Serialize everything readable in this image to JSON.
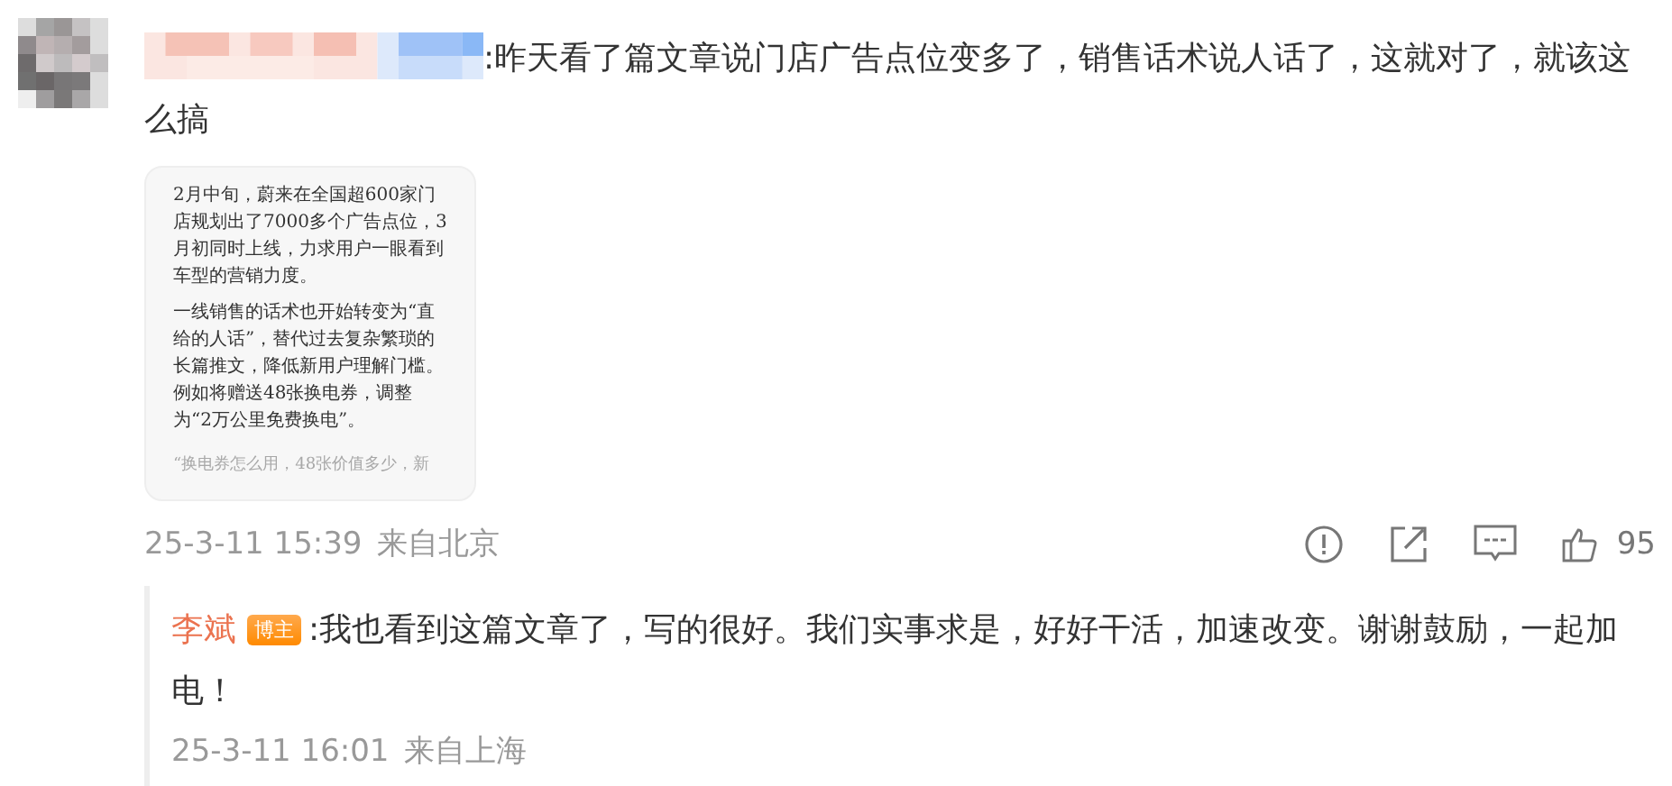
{
  "comment": {
    "text": ":昨天看了篇文章说门店广告点位变多了，销售话术说人话了，这就对了，就该这么搞",
    "attachment": {
      "paragraphs": [
        "2月中旬，蔚来在全国超600家门店规划出了7000多个广告点位，3月初同时上线，力求用户一眼看到车型的营销力度。",
        "一线销售的话术也开始转变为“直给的人话”，替代过去复杂繁琐的长篇推文，降低新用户理解门槛。例如将赠送48张换电券，调整为“2万公里免费换电”。"
      ],
      "faded": "“换电券怎么用，48张价值多少，新"
    },
    "time": "25-3-11 15:39",
    "location": "来自北京",
    "likes": "95"
  },
  "reply": {
    "author": "李斌",
    "badge": "博主",
    "text": ":我也看到这篇文章了，写的很好。我们实事求是，好好干活，加速改变。谢谢鼓励，一起加电！",
    "time": "25-3-11 16:01",
    "location": "来自上海"
  }
}
